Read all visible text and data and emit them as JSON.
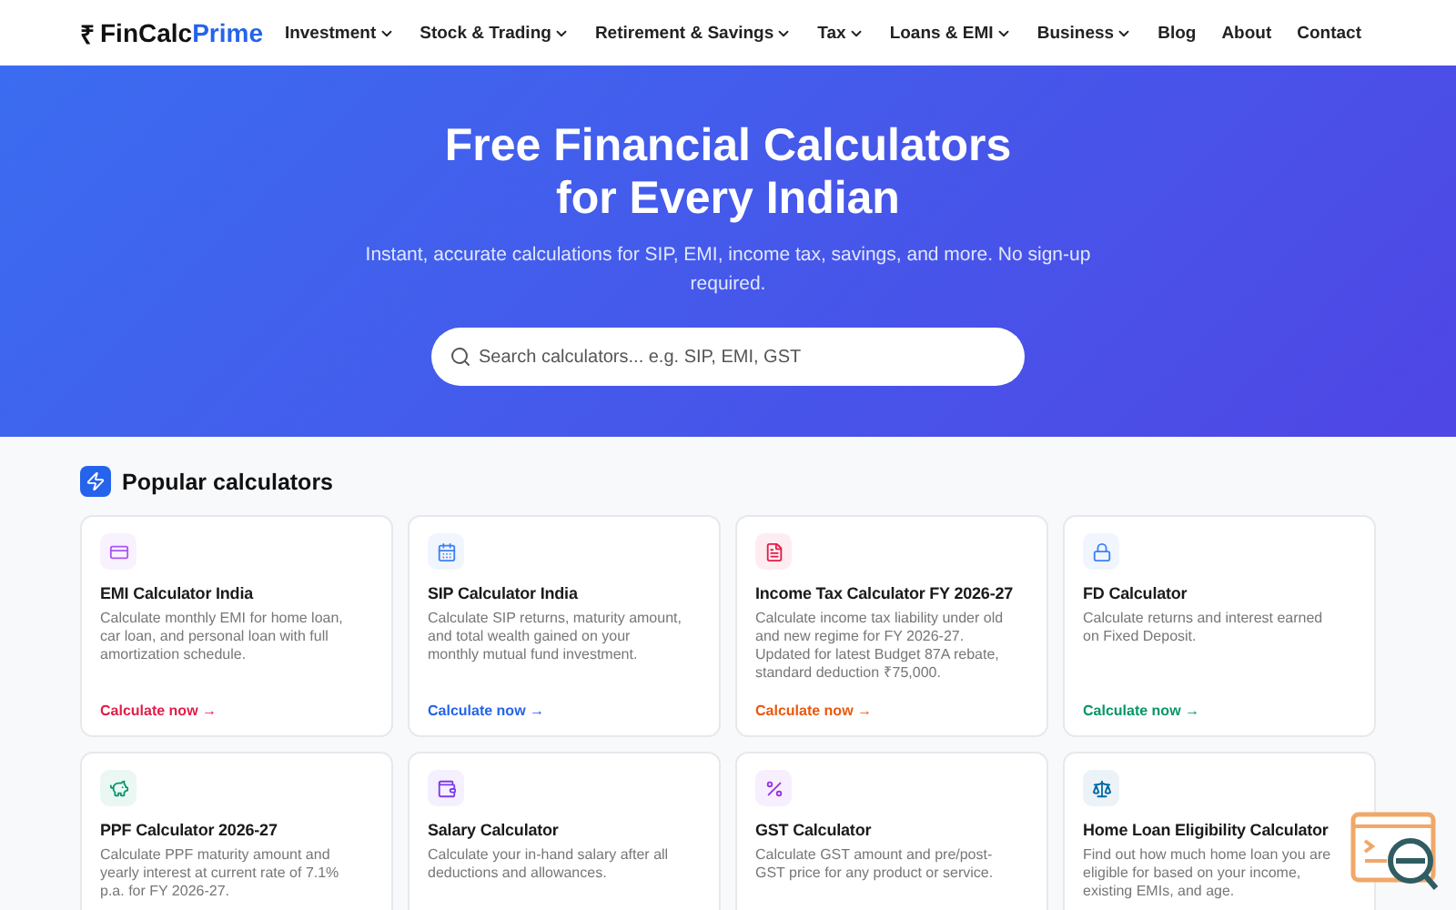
{
  "brand": {
    "symbol": "₹",
    "name": "FinCalc",
    "accent": "Prime"
  },
  "nav": [
    {
      "label": "Investment",
      "has_menu": true
    },
    {
      "label": "Stock & Trading",
      "has_menu": true
    },
    {
      "label": "Retirement & Savings",
      "has_menu": true
    },
    {
      "label": "Tax",
      "has_menu": true
    },
    {
      "label": "Loans & EMI",
      "has_menu": true
    },
    {
      "label": "Business",
      "has_menu": true
    },
    {
      "label": "Blog",
      "has_menu": false
    },
    {
      "label": "About",
      "has_menu": false
    },
    {
      "label": "Contact",
      "has_menu": false
    }
  ],
  "hero": {
    "title_lines": [
      "Free Financial Calculators",
      "for Every Indian"
    ],
    "subtitle": "Instant, accurate calculations for SIP, EMI, income tax, savings, and more. No sign-up required.",
    "search": {
      "placeholder": "Search calculators... e.g. SIP, EMI, GST"
    }
  },
  "section": {
    "title": "Popular calculators"
  },
  "cards": [
    {
      "kind": "card",
      "color": "#a855f7",
      "title": "EMI Calculator India",
      "description": "Calculate monthly EMI for home loan, car loan, and personal loan with full amortization schedule.",
      "link": {
        "text": "Calculate now →",
        "color": "#e11d48"
      }
    },
    {
      "kind": "calendar",
      "color": "#3b82f6",
      "title": "SIP Calculator India",
      "description": "Calculate SIP returns, maturity amount, and total wealth gained on your monthly mutual fund investment.",
      "link": {
        "text": "Calculate now →",
        "color": "#2563eb"
      }
    },
    {
      "kind": "document",
      "color": "#e11d48",
      "title": "Income Tax Calculator FY 2026-27",
      "description": "Calculate income tax liability under old and new regime for FY 2026-27. Updated for latest Budget 87A rebate, standard deduction ₹75,000.",
      "link": {
        "text": "Calculate now →",
        "color": "#ea580c"
      }
    },
    {
      "kind": "lock",
      "color": "#3b82f6",
      "title": "FD Calculator",
      "description": "Calculate returns and interest earned on Fixed Deposit.",
      "link": {
        "text": "Calculate now →",
        "color": "#059669"
      }
    },
    {
      "kind": "piggy",
      "color": "#059669",
      "title": "PPF Calculator 2026-27",
      "description": "Calculate PPF maturity amount and yearly interest at current rate of 7.1% p.a. for FY 2026-27."
    },
    {
      "kind": "wallet",
      "color": "#7c3aed",
      "title": "Salary Calculator",
      "description": "Calculate your in-hand salary after all deductions and allowances."
    },
    {
      "kind": "percent",
      "color": "#9333ea",
      "title": "GST Calculator",
      "description": "Calculate GST amount and pre/post-GST price for any product or service."
    },
    {
      "kind": "scale",
      "color": "#0369a1",
      "title": "Home Loan Eligibility Calculator",
      "description": "Find out how much home loan you are eligible for based on your income, existing EMIs, and age."
    }
  ]
}
